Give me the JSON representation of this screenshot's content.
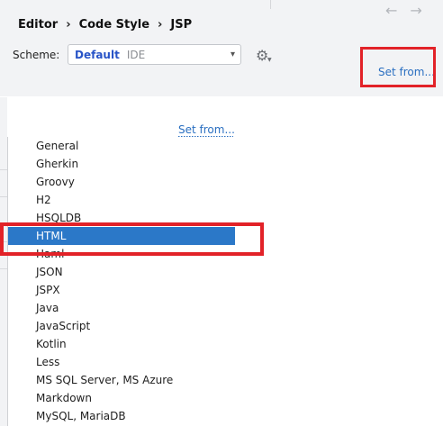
{
  "breadcrumb": [
    "Editor",
    "Code Style",
    "JSP"
  ],
  "breadcrumb_separator": "›",
  "nav": {
    "back_glyph": "←",
    "forward_glyph": "→"
  },
  "scheme": {
    "label": "Scheme:",
    "selected_name": "Default",
    "selected_sub": "IDE",
    "caret": "▾"
  },
  "gear_glyph": "⚙",
  "gear_caret": "▼",
  "set_from_label": "Set from...",
  "languages": [
    "General",
    "Gherkin",
    "Groovy",
    "H2",
    "HSQLDB",
    "HTML",
    "Haml",
    "JSON",
    "JSPX",
    "Java",
    "JavaScript",
    "Kotlin",
    "Less",
    "MS SQL Server, MS Azure",
    "Markdown",
    "MySQL, MariaDB"
  ],
  "selected_language": "HTML",
  "colors": {
    "accent": "#2b78c8",
    "link": "#2a6fc1",
    "annotation_red": "#e22228",
    "scheme_name": "#2753c7"
  }
}
